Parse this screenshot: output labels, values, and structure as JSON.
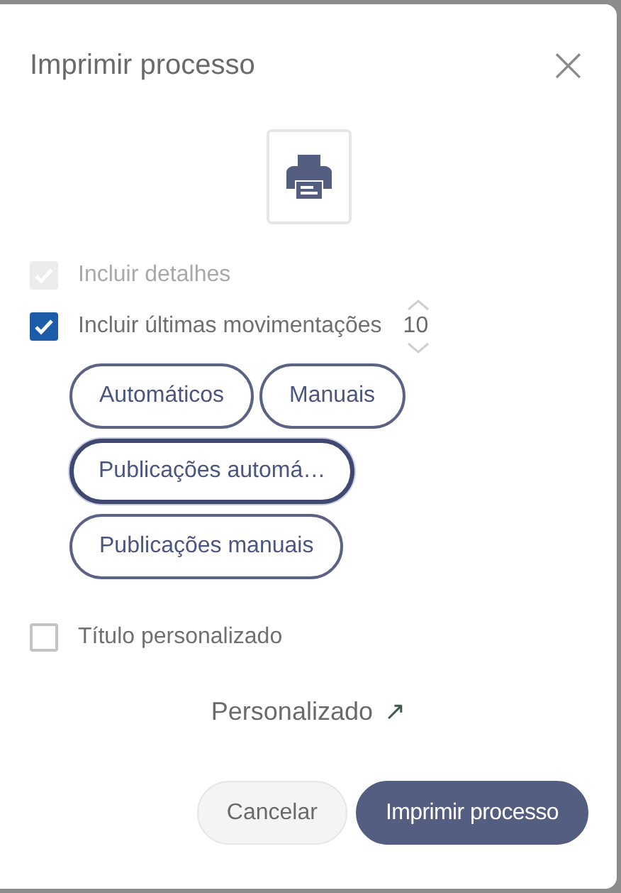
{
  "dialog": {
    "title": "Imprimir processo",
    "close": "×"
  },
  "options": [
    {
      "label": "Incluir detalhes",
      "checked": true,
      "disabled": true
    },
    {
      "label": "Incluir últimas movimentações",
      "checked": true,
      "disabled": false,
      "count": "10"
    }
  ],
  "chips": [
    {
      "label": "Automáticos",
      "focused": false
    },
    {
      "label": "Manuais",
      "focused": false
    },
    {
      "label": "Publicações automá…",
      "focused": true
    },
    {
      "label": "Publicações manuais",
      "focused": false
    }
  ],
  "custom_title": {
    "label": "Título personalizado",
    "checked": false,
    "disabled": false
  },
  "link": {
    "label": "Personalizado",
    "arrow": "↗"
  },
  "buttons": [
    {
      "label": "Cancelar",
      "kind": "secondary"
    },
    {
      "label": "Imprimir processo",
      "kind": "primary"
    }
  ]
}
